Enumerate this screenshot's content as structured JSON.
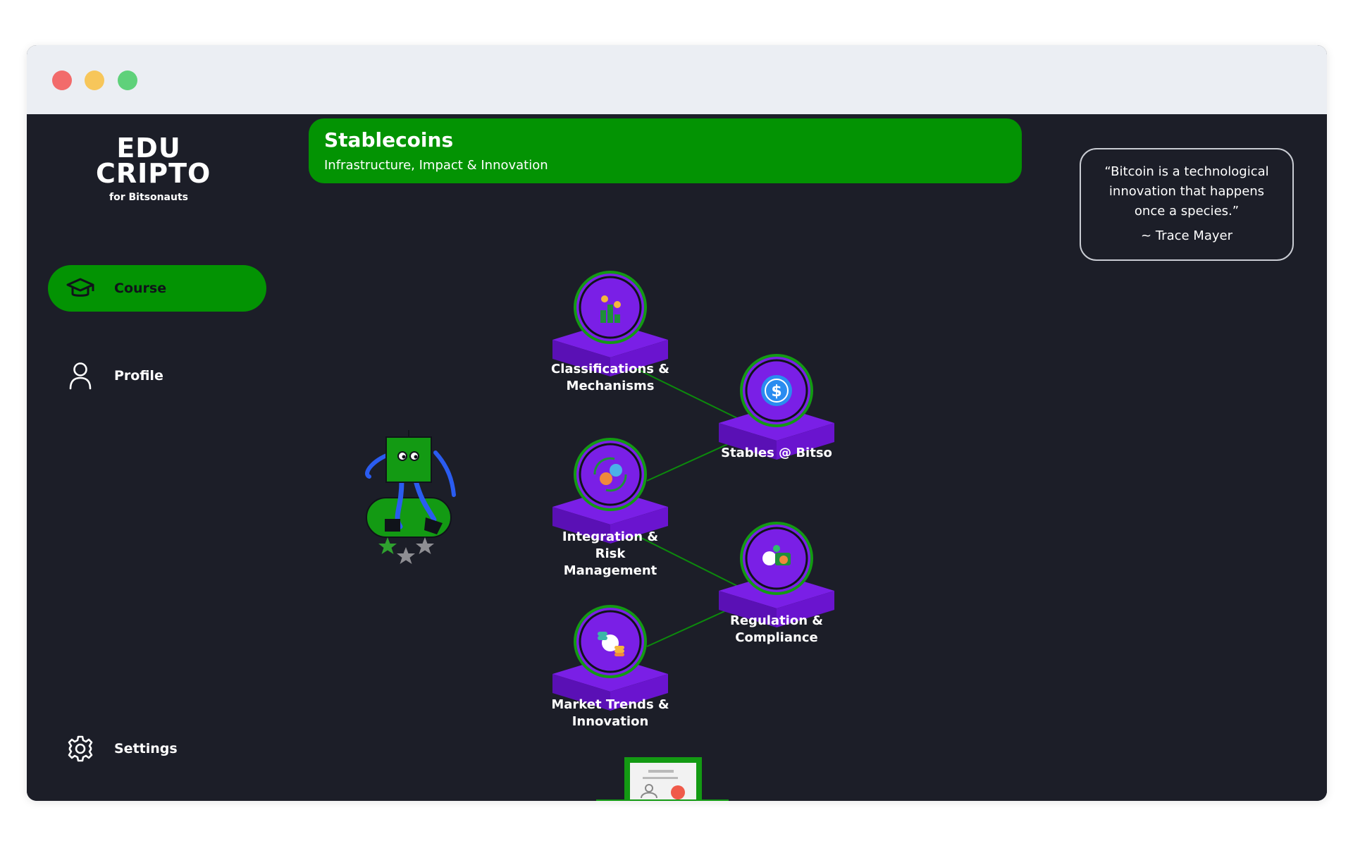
{
  "window": {
    "controls": [
      "close",
      "minimize",
      "maximize"
    ]
  },
  "brand": {
    "logo_line1": "EDU",
    "logo_line2": "CRIPTO",
    "logo_sub": "for Bitsonauts"
  },
  "sidebar": {
    "items": [
      {
        "label": "Course",
        "icon": "graduation-cap-icon",
        "active": true
      },
      {
        "label": "Profile",
        "icon": "user-icon",
        "active": false
      },
      {
        "label": "Settings",
        "icon": "gear-icon",
        "active": false
      }
    ]
  },
  "course": {
    "title": "Stablecoins",
    "subtitle": "Infrastructure, Impact & Innovation"
  },
  "quote": {
    "text": "“Bitcoin is a technological innovation that happens once a species.”",
    "author": "~ Trace Mayer"
  },
  "modules": [
    {
      "label_lines": [
        "Classifications &",
        "Mechanisms"
      ],
      "icon": "coins-growth-icon"
    },
    {
      "label_lines": [
        "Stables @ Bitso"
      ],
      "icon": "dollar-coin-icon"
    },
    {
      "label_lines": [
        "Integration &",
        "Risk",
        "Management"
      ],
      "icon": "currency-exchange-icon"
    },
    {
      "label_lines": [
        "Regulation &",
        "Compliance"
      ],
      "icon": "money-scale-icon"
    },
    {
      "label_lines": [
        "Market Trends &",
        "Innovation"
      ],
      "icon": "coin-stacks-icon"
    }
  ],
  "mascot": {
    "stars_earned": 1,
    "stars_total": 3
  },
  "certificate": {
    "icon": "certificate-icon"
  },
  "colors": {
    "accent_green": "#039303",
    "background": "#1c1e28",
    "node_purple": "#7a1fe6",
    "node_purple_dark": "#5a10b5",
    "star_gray": "#8e8e93"
  }
}
